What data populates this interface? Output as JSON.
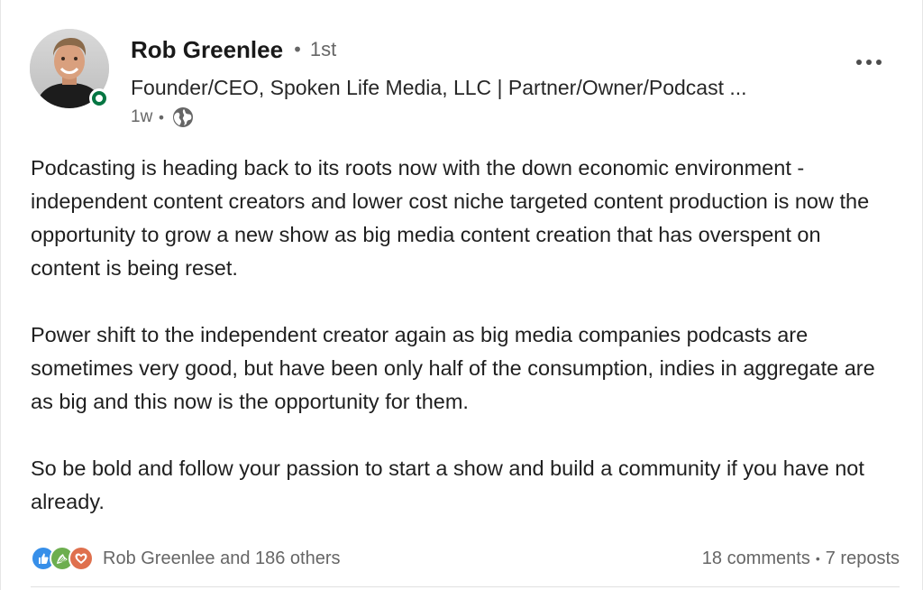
{
  "author": {
    "name": "Rob Greenlee",
    "connection_degree": "1st",
    "headline": "Founder/CEO, Spoken Life Media, LLC | Partner/Owner/Podcast ...",
    "timestamp": "1w",
    "visibility_icon": "globe-icon",
    "presence_status": "online"
  },
  "post": {
    "paragraphs": [
      "Podcasting is heading back to its roots now with the down economic environment - independent content creators and lower cost niche targeted content production is now the opportunity to grow a new show as big media content creation that has overspent on content is being reset.",
      "Power shift to the independent creator again as big media companies podcasts are sometimes very good, but have been only half of the consumption, indies in aggregate are as big and this now is the opportunity for them.",
      "So be bold and follow your passion to start a show and build a community if you have not already."
    ]
  },
  "social": {
    "reaction_icons": [
      "like-icon",
      "support-icon",
      "love-icon"
    ],
    "reaction_summary": "Rob Greenlee and 186 others",
    "comments": "18 comments",
    "separator": "•",
    "reposts": "7 reposts"
  },
  "colors": {
    "presence": "#057642",
    "like": "#378fe9",
    "support": "#6dae4f",
    "love": "#df704d",
    "muted_text": "#666666"
  }
}
